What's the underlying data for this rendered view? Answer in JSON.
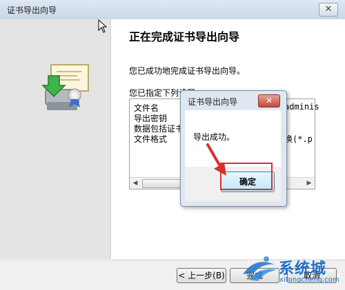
{
  "wizard": {
    "title": "证书导出向导",
    "close_glyph": "✕",
    "heading": "正在完成证书导出向导",
    "message": "您已成功地完成证书导出向导。",
    "specified_label": "您已指定下列设置:",
    "rows": [
      {
        "name": "文件名",
        "value": "adminis"
      },
      {
        "name": "导出密钥",
        "value": ""
      },
      {
        "name": "数据包括证书",
        "value": ""
      },
      {
        "name": "文件格式",
        "value": "换(*.p"
      }
    ],
    "buttons": {
      "back": "< 上一步(B)",
      "finish": "完成",
      "cancel": "取消"
    }
  },
  "dialog": {
    "title": "证书导出向导",
    "close_glyph": "✕",
    "message": "导出成功。",
    "ok": "确定"
  },
  "watermark": {
    "brand": "系统城",
    "url": "xitongcheng.com"
  },
  "colors": {
    "highlight": "#d9302a",
    "watermark": "#1e73c8"
  }
}
